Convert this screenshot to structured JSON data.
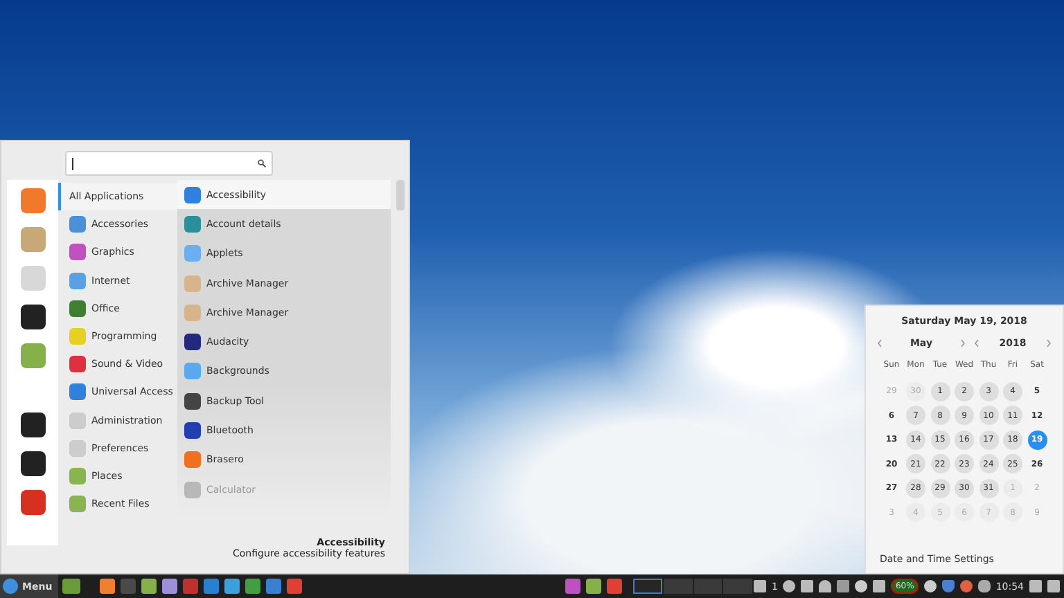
{
  "menu": {
    "categories": [
      {
        "label": "All Applications",
        "selected": true
      },
      {
        "label": "Accessories",
        "selected": false
      },
      {
        "label": "Graphics",
        "selected": false
      },
      {
        "label": "Internet",
        "selected": false
      },
      {
        "label": "Office",
        "selected": false
      },
      {
        "label": "Programming",
        "selected": false
      },
      {
        "label": "Sound & Video",
        "selected": false
      },
      {
        "label": "Universal Access",
        "selected": false
      },
      {
        "label": "Administration",
        "selected": false
      },
      {
        "label": "Preferences",
        "selected": false
      },
      {
        "label": "Places",
        "selected": false
      },
      {
        "label": "Recent Files",
        "selected": false
      }
    ],
    "apps": [
      {
        "label": "Accessibility",
        "selected": true,
        "disabled": false
      },
      {
        "label": "Account details",
        "selected": false,
        "disabled": false
      },
      {
        "label": "Applets",
        "selected": false,
        "disabled": false
      },
      {
        "label": "Archive Manager",
        "selected": false,
        "disabled": false
      },
      {
        "label": "Archive Manager",
        "selected": false,
        "disabled": false
      },
      {
        "label": "Audacity",
        "selected": false,
        "disabled": false
      },
      {
        "label": "Backgrounds",
        "selected": false,
        "disabled": false
      },
      {
        "label": "Backup Tool",
        "selected": false,
        "disabled": false
      },
      {
        "label": "Bluetooth",
        "selected": false,
        "disabled": false
      },
      {
        "label": "Brasero",
        "selected": false,
        "disabled": false
      },
      {
        "label": "Calculator",
        "selected": false,
        "disabled": true
      }
    ],
    "description": {
      "title": "Accessibility",
      "text": "Configure accessibility features"
    }
  },
  "calendar": {
    "date_title": "Saturday May 19, 2018",
    "month": "May",
    "year": "2018",
    "weekdays": [
      "Sun",
      "Mon",
      "Tue",
      "Wed",
      "Thu",
      "Fri",
      "Sat"
    ],
    "weeks": [
      [
        {
          "day": "29",
          "other": true,
          "selected": false
        },
        {
          "day": "30",
          "other": true,
          "selected": false
        },
        {
          "day": "1",
          "other": false,
          "selected": false
        },
        {
          "day": "2",
          "other": false,
          "selected": false
        },
        {
          "day": "3",
          "other": false,
          "selected": false
        },
        {
          "day": "4",
          "other": false,
          "selected": false
        },
        {
          "day": "5",
          "other": false,
          "selected": false
        }
      ],
      [
        {
          "day": "6",
          "other": false,
          "selected": false
        },
        {
          "day": "7",
          "other": false,
          "selected": false
        },
        {
          "day": "8",
          "other": false,
          "selected": false
        },
        {
          "day": "9",
          "other": false,
          "selected": false
        },
        {
          "day": "10",
          "other": false,
          "selected": false
        },
        {
          "day": "11",
          "other": false,
          "selected": false
        },
        {
          "day": "12",
          "other": false,
          "selected": false
        }
      ],
      [
        {
          "day": "13",
          "other": false,
          "selected": false
        },
        {
          "day": "14",
          "other": false,
          "selected": false
        },
        {
          "day": "15",
          "other": false,
          "selected": false
        },
        {
          "day": "16",
          "other": false,
          "selected": false
        },
        {
          "day": "17",
          "other": false,
          "selected": false
        },
        {
          "day": "18",
          "other": false,
          "selected": false
        },
        {
          "day": "19",
          "other": false,
          "selected": true
        }
      ],
      [
        {
          "day": "20",
          "other": false,
          "selected": false
        },
        {
          "day": "21",
          "other": false,
          "selected": false
        },
        {
          "day": "22",
          "other": false,
          "selected": false
        },
        {
          "day": "23",
          "other": false,
          "selected": false
        },
        {
          "day": "24",
          "other": false,
          "selected": false
        },
        {
          "day": "25",
          "other": false,
          "selected": false
        },
        {
          "day": "26",
          "other": false,
          "selected": false
        }
      ],
      [
        {
          "day": "27",
          "other": false,
          "selected": false
        },
        {
          "day": "28",
          "other": false,
          "selected": false
        },
        {
          "day": "29",
          "other": false,
          "selected": false
        },
        {
          "day": "30",
          "other": false,
          "selected": false
        },
        {
          "day": "31",
          "other": false,
          "selected": false
        },
        {
          "day": "1",
          "other": true,
          "selected": false
        },
        {
          "day": "2",
          "other": true,
          "selected": false
        }
      ],
      [
        {
          "day": "3",
          "other": true,
          "selected": false
        },
        {
          "day": "4",
          "other": true,
          "selected": false
        },
        {
          "day": "5",
          "other": true,
          "selected": false
        },
        {
          "day": "6",
          "other": true,
          "selected": false
        },
        {
          "day": "7",
          "other": true,
          "selected": false
        },
        {
          "day": "8",
          "other": true,
          "selected": false
        },
        {
          "day": "9",
          "other": true,
          "selected": false
        }
      ]
    ],
    "settings_link": "Date and Time Settings"
  },
  "taskbar": {
    "menu_label": "Menu",
    "workspaces": [
      {
        "selected": true
      },
      {
        "selected": false
      },
      {
        "selected": false
      },
      {
        "selected": false
      }
    ],
    "notification_count": "1",
    "battery_badge": "60%",
    "clock": "10:54"
  }
}
